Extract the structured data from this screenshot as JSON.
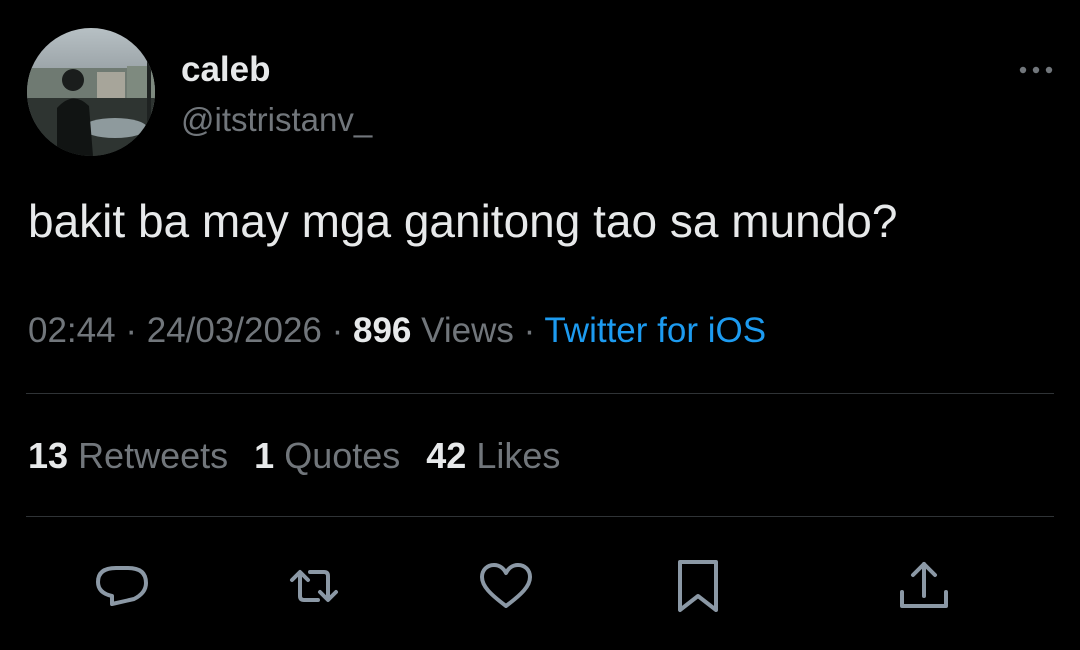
{
  "author": {
    "display_name": "caleb",
    "handle": "@itstristanv_"
  },
  "tweet": {
    "text": "bakit ba may mga ganitong tao sa mundo?",
    "time": "02:44",
    "date": "24/03/2026",
    "views_count": "896",
    "views_label": "Views",
    "source": "Twitter for iOS",
    "separator": " · "
  },
  "stats": {
    "retweets_count": "13",
    "retweets_label": "Retweets",
    "quotes_count": "1",
    "quotes_label": "Quotes",
    "likes_count": "42",
    "likes_label": "Likes"
  },
  "actions": [
    "reply-icon",
    "retweet-icon",
    "like-icon",
    "bookmark-icon",
    "share-icon"
  ],
  "colors": {
    "background": "#000000",
    "primary_text": "#e7e9ea",
    "secondary_text": "#71767b",
    "link": "#1d9bf0",
    "divider": "#2f3336"
  }
}
